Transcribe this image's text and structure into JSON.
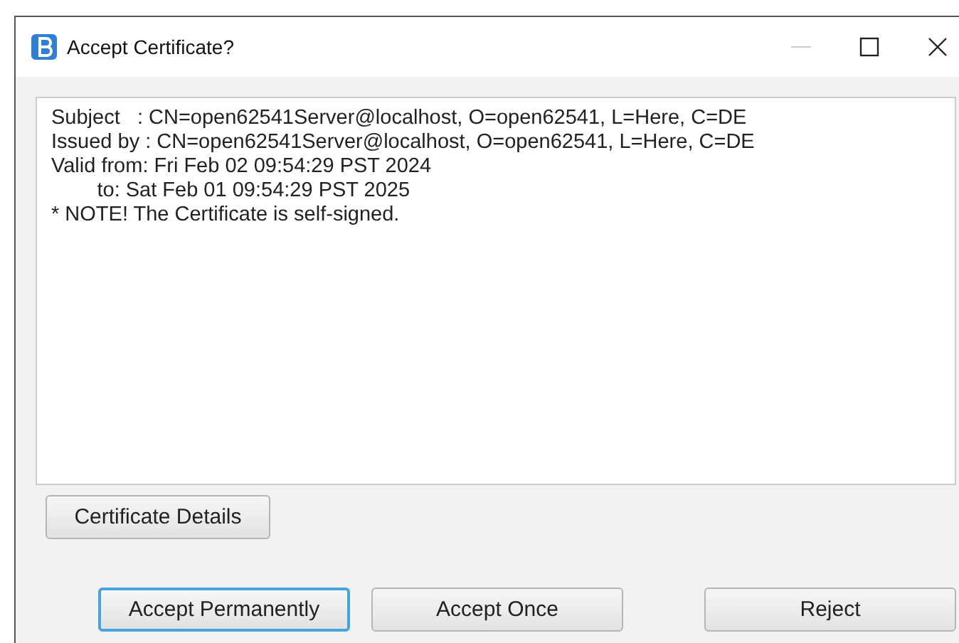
{
  "window": {
    "title": "Accept Certificate?"
  },
  "certificate_text": [
    "Subject   : CN=open62541Server@localhost, O=open62541, L=Here, C=DE",
    "Issued by : CN=open62541Server@localhost, O=open62541, L=Here, C=DE",
    "Valid from: Fri Feb 02 09:54:29 PST 2024",
    "        to: Sat Feb 01 09:54:29 PST 2025",
    "* NOTE! The Certificate is self-signed."
  ],
  "details_button": "Certificate Details",
  "buttons": [
    {
      "label": "Accept Permanently",
      "focused": true
    },
    {
      "label": "Accept Once",
      "focused": false
    },
    {
      "label": "Reject",
      "focused": false
    }
  ]
}
